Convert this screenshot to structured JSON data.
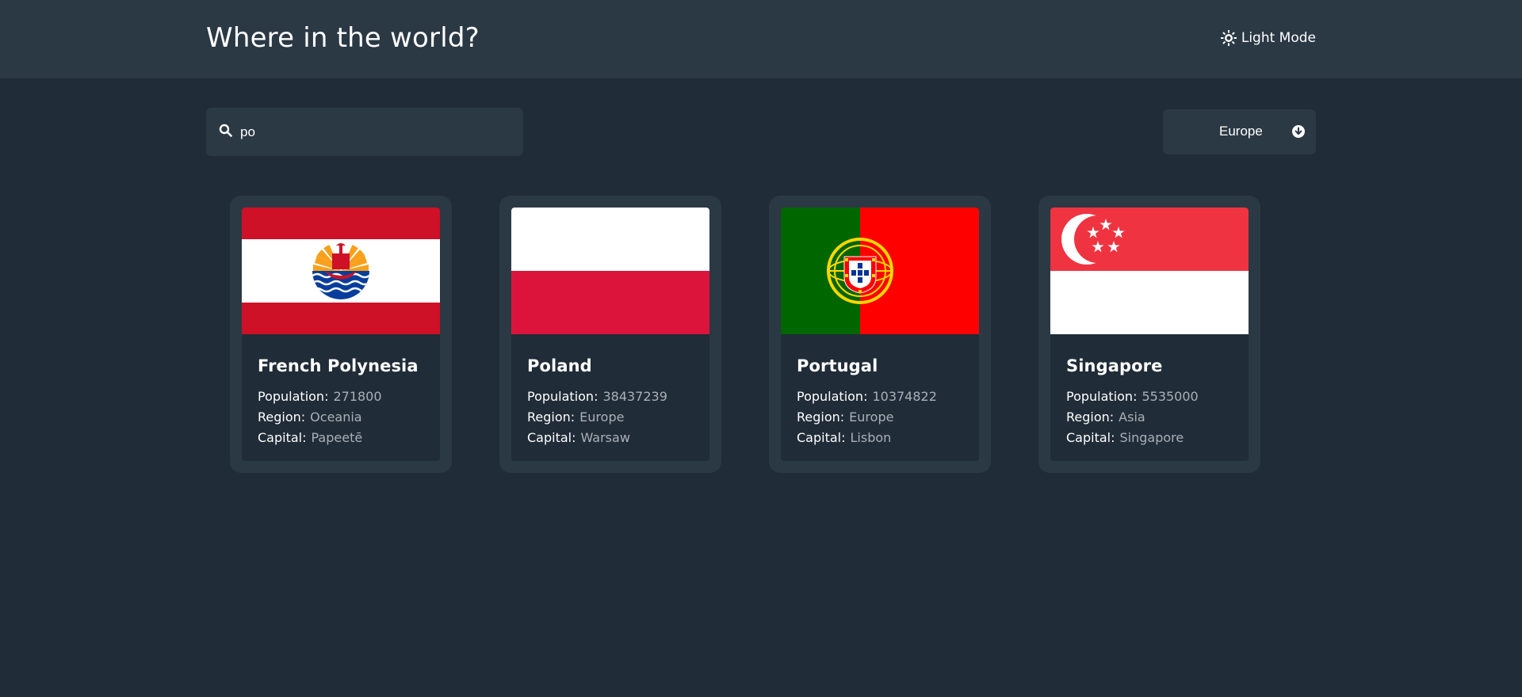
{
  "header": {
    "title": "Where in the world?",
    "theme_toggle_label": "Light Mode",
    "theme_icon": "sun-icon"
  },
  "search": {
    "value": "po",
    "icon": "search-icon"
  },
  "filter": {
    "selected": "Europe",
    "icon": "arrow-down-circle-icon"
  },
  "labels": {
    "population": "Population:",
    "region": "Region:",
    "capital": "Capital:"
  },
  "countries": [
    {
      "name": "French Polynesia",
      "population": "271800",
      "region": "Oceania",
      "capital": "Papeetē",
      "flag": "french-polynesia-flag"
    },
    {
      "name": "Poland",
      "population": "38437239",
      "region": "Europe",
      "capital": "Warsaw",
      "flag": "poland-flag"
    },
    {
      "name": "Portugal",
      "population": "10374822",
      "region": "Europe",
      "capital": "Lisbon",
      "flag": "portugal-flag"
    },
    {
      "name": "Singapore",
      "population": "5535000",
      "region": "Asia",
      "capital": "Singapore",
      "flag": "singapore-flag"
    }
  ],
  "colors": {
    "background": "#202c37",
    "elements": "#2b3945",
    "text": "#ffffff",
    "muted_text": "#a9b0b8"
  }
}
